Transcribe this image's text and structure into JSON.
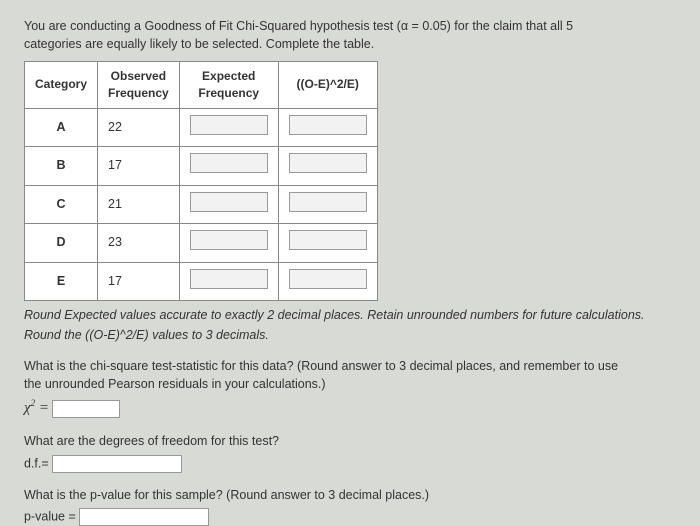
{
  "prompt_line1": "You are conducting a Goodness of Fit Chi-Squared hypothesis test (α = 0.05) for the claim that all 5",
  "prompt_line2": "categories are equally likely to be selected. Complete the table.",
  "headers": {
    "category": "Category",
    "observed": "Observed Frequency",
    "expected": "Expected Frequency",
    "residual": "((O-E)^2/E)"
  },
  "rows": [
    {
      "cat": "A",
      "obs": "22"
    },
    {
      "cat": "B",
      "obs": "17"
    },
    {
      "cat": "C",
      "obs": "21"
    },
    {
      "cat": "D",
      "obs": "23"
    },
    {
      "cat": "E",
      "obs": "17"
    }
  ],
  "note1": "Round Expected values accurate to exactly 2 decimal places. Retain unrounded numbers for future calculations.",
  "note2": "Round the ((O-E)^2/E) values to 3 decimals.",
  "q1_line1": "What is the chi-square test-statistic for this data? (Round answer to 3 decimal places, and remember to use",
  "q1_line2": "the unrounded Pearson residuals in your calculations.)",
  "q1_formula": "χ² =",
  "q2": "What are the degrees of freedom for this test?",
  "q2_label": "d.f.=",
  "q3": "What is the p-value for this sample? (Round answer to 3 decimal places.)",
  "q3_label": "p-value ="
}
